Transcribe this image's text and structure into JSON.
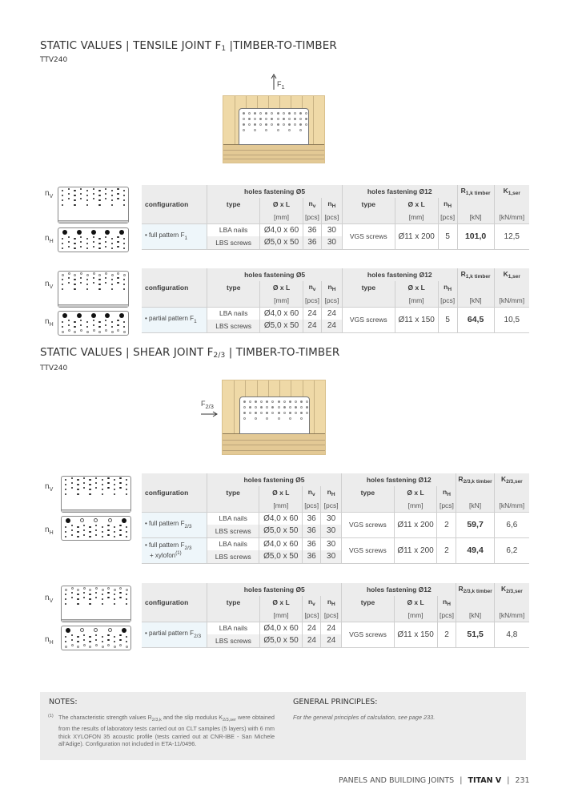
{
  "section1": {
    "title_pre": "STATIC VALUES | TENSILE JOINT F",
    "title_sub": "1",
    "title_post": " |TIMBER-TO-TIMBER",
    "product": "TTV240",
    "force_label": "F",
    "force_sub": "1"
  },
  "section2": {
    "title_pre": "STATIC VALUES | SHEAR JOINT F",
    "title_sub": "2/3",
    "title_post": "  | TIMBER-TO-TIMBER",
    "product": "TTV240",
    "force_label": "F",
    "force_sub": "2/3"
  },
  "labels": {
    "nv": "n",
    "nv_sub": "V",
    "nh": "n",
    "nh_sub": "H"
  },
  "table_headers": {
    "configuration": "configuration",
    "holes5": "holes fastening Ø5",
    "holes12": "holes fastening Ø12",
    "type": "type",
    "dxl": "Ø x L",
    "nv": "n",
    "nv_sub": "v",
    "nh": "n",
    "nh_sub": "H",
    "mm": "[mm]",
    "pcs": "[pcs]",
    "kn": "[kN]",
    "knmm": "[kN/mm]"
  },
  "tables": [
    {
      "r_label": "R",
      "r_sub": "1,k timber",
      "k_label": "K",
      "k_sub": "1,ser",
      "groups": [
        {
          "config": "• full pattern F",
          "config_sub": "1",
          "config_extra": "",
          "config_sup": "",
          "rows": [
            {
              "type": "LBA nails",
              "dxl": "Ø4,0 x 60",
              "nv": "36",
              "nh": "30"
            },
            {
              "type": "LBS screws",
              "dxl": "Ø5,0 x 50",
              "nv": "36",
              "nh": "30"
            }
          ],
          "type12": "VGS screws",
          "dxl12": "Ø11 x 200",
          "nh12": "5",
          "r": "101,0",
          "k": "12,5"
        }
      ]
    },
    {
      "r_label": "R",
      "r_sub": "1,k timber",
      "k_label": "K",
      "k_sub": "1,ser",
      "groups": [
        {
          "config": "• partial pattern F",
          "config_sub": "1",
          "config_extra": "",
          "config_sup": "",
          "rows": [
            {
              "type": "LBA nails",
              "dxl": "Ø4,0 x 60",
              "nv": "24",
              "nh": "24"
            },
            {
              "type": "LBS screws",
              "dxl": "Ø5,0 x 50",
              "nv": "24",
              "nh": "24"
            }
          ],
          "type12": "VGS screws",
          "dxl12": "Ø11 x 150",
          "nh12": "5",
          "r": "64,5",
          "k": "10,5"
        }
      ]
    },
    {
      "r_label": "R",
      "r_sub": "2/3,k timber",
      "k_label": "K",
      "k_sub": "2/3,ser",
      "groups": [
        {
          "config": "• full pattern F",
          "config_sub": "2/3",
          "config_extra": "",
          "config_sup": "",
          "rows": [
            {
              "type": "LBA nails",
              "dxl": "Ø4,0 x 60",
              "nv": "36",
              "nh": "30"
            },
            {
              "type": "LBS screws",
              "dxl": "Ø5,0 x 50",
              "nv": "36",
              "nh": "30"
            }
          ],
          "type12": "VGS screws",
          "dxl12": "Ø11 x 200",
          "nh12": "2",
          "r": "59,7",
          "k": "6,6"
        },
        {
          "config": "• full pattern F",
          "config_sub": "2/3",
          "config_extra": "+ xylofon",
          "config_sup": "(1)",
          "rows": [
            {
              "type": "LBA nails",
              "dxl": "Ø4,0 x 60",
              "nv": "36",
              "nh": "30"
            },
            {
              "type": "LBS screws",
              "dxl": "Ø5,0 x 50",
              "nv": "36",
              "nh": "30"
            }
          ],
          "type12": "VGS screws",
          "dxl12": "Ø11 x 200",
          "nh12": "2",
          "r": "49,4",
          "k": "6,2"
        }
      ]
    },
    {
      "r_label": "R",
      "r_sub": "2/3,k timber",
      "k_label": "K",
      "k_sub": "2/3,ser",
      "groups": [
        {
          "config": "• partial pattern F",
          "config_sub": "2/3",
          "config_extra": "",
          "config_sup": "",
          "rows": [
            {
              "type": "LBA nails",
              "dxl": "Ø4,0 x 60",
              "nv": "24",
              "nh": "24"
            },
            {
              "type": "LBS screws",
              "dxl": "Ø5,0 x 50",
              "nv": "24",
              "nh": "24"
            }
          ],
          "type12": "VGS screws",
          "dxl12": "Ø11 x 150",
          "nh12": "2",
          "r": "51,5",
          "k": "4,8"
        }
      ]
    }
  ],
  "notes": {
    "title": "NOTES:",
    "num": "(1)",
    "t1": "The characteristic strength values R",
    "t1_sub": "2/3,k",
    "t2": " and the slip modulus K",
    "t2_sub": "2/3,ser",
    "t3": " were obtained from the results of laboratory tests carried out on CLT samples (5 layers) with 6 mm thick XYLOFON 35 acoustic profile (tests carried out at CNR-IBE - San Michele all'Adige). Configuration not included in ETA-11/0496."
  },
  "general": {
    "title": "GENERAL PRINCIPLES:",
    "text": "For the general principles of calculation, see page 233."
  },
  "footer": {
    "section": "PANELS AND BUILDING JOINTS",
    "sep": "|",
    "product": "TITAN V",
    "page": "231"
  }
}
